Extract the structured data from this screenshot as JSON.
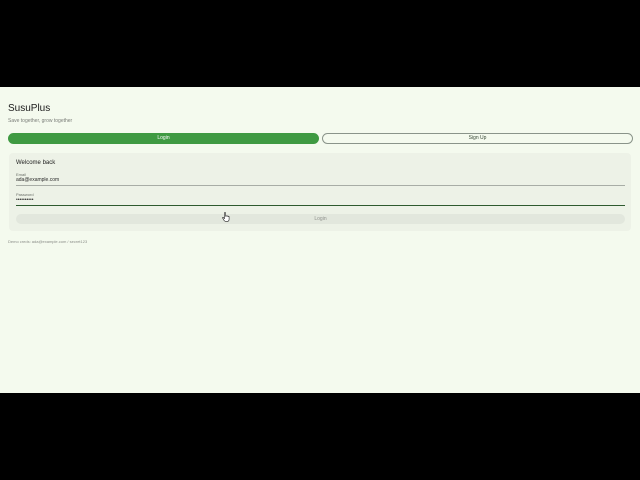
{
  "app": {
    "title": "SusuPlus",
    "subtitle": "Save together, grow together"
  },
  "tabs": [
    {
      "label": "Login",
      "active": true
    },
    {
      "label": "Sign Up",
      "active": false
    }
  ],
  "card": {
    "title": "Welcome back",
    "email": {
      "label": "Email",
      "value": "ada@example.com"
    },
    "password": {
      "label": "Password",
      "value": "••••••••••"
    },
    "submit_label": "Login"
  },
  "demo_hint": "Demo creds: ada@example.com / secret123",
  "cursor": "hand-pointer-icon",
  "colors": {
    "primary": "#3f9a42",
    "background": "#f4faee",
    "card": "#edf2e7"
  }
}
